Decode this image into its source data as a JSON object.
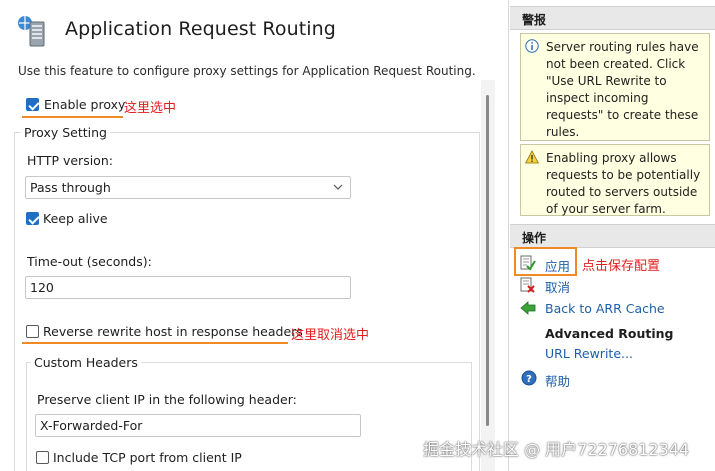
{
  "main": {
    "title": "Application Request Routing",
    "description": "Use this feature to configure proxy settings for Application Request Routing.",
    "enable_proxy": {
      "label": "Enable proxy",
      "checked": true,
      "note": "这里选中"
    },
    "proxy_setting": {
      "group_label": "Proxy Setting",
      "http_version_label": "HTTP version:",
      "http_version_value": "Pass through",
      "keep_alive": {
        "label": "Keep alive",
        "checked": true
      },
      "timeout_label": "Time-out (seconds):",
      "timeout_value": "120",
      "reverse_rewrite": {
        "label": "Reverse rewrite host in response headers",
        "checked": false,
        "note": "这里取消选中"
      },
      "custom_headers": {
        "group_label": "Custom Headers",
        "preserve_ip_label": "Preserve client IP in the following header:",
        "preserve_ip_value": "X-Forwarded-For",
        "include_tcp_port": {
          "label": "Include TCP port from client IP",
          "checked": false
        }
      }
    }
  },
  "side": {
    "alerts_header": "警报",
    "alerts": [
      "Server routing rules have not been created. Click \"Use URL Rewrite to inspect incoming requests\" to create these rules.",
      "Enabling proxy allows requests to be potentially routed to servers outside of your server farm."
    ],
    "actions_header": "操作",
    "apply_label": "应用",
    "apply_note": "点击保存配置",
    "cancel_label": "取消",
    "back_label": "Back to ARR Cache",
    "advanced_routing_label": "Advanced Routing",
    "url_rewrite_label": "URL Rewrite...",
    "help_label": "帮助"
  },
  "watermark": "掘金技术社区 @ 用户722768123​44",
  "colors": {
    "accent": "#1f6fc5",
    "link": "#1d5fa8",
    "annotation": "#e02020",
    "highlight": "#f08a24",
    "alert_bg": "#ffffe1"
  }
}
